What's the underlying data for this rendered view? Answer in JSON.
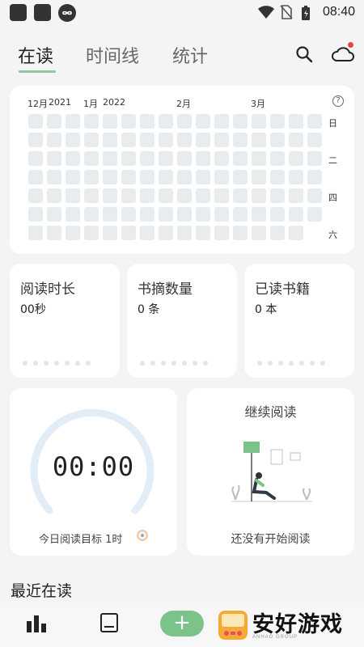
{
  "status_bar": {
    "time": "08:40"
  },
  "tabs": [
    {
      "label": "在读"
    },
    {
      "label": "时间线"
    },
    {
      "label": "统计"
    }
  ],
  "heatmap": {
    "months": [
      {
        "label": "12月"
      },
      {
        "label": "2021"
      },
      {
        "label": "1月"
      },
      {
        "label": "2022"
      },
      {
        "label": "2月"
      },
      {
        "label": "3月"
      }
    ],
    "weekdays": [
      "日",
      "二",
      "四",
      "六"
    ],
    "help": "?"
  },
  "stats": [
    {
      "title": "阅读时长",
      "value": "00秒"
    },
    {
      "title": "书摘数量",
      "value": "0 条"
    },
    {
      "title": "已读书籍",
      "value": "0 本"
    }
  ],
  "timer": {
    "time": "00:00",
    "goal_label": "今日阅读目标 1时"
  },
  "continue_reading": {
    "title": "继续阅读",
    "empty_text": "还没有开始阅读"
  },
  "recent_title": "最近在读",
  "bottom_nav": {
    "fab_label": "+"
  },
  "watermark": {
    "text": "安好游戏",
    "sub": "ANHAO GROUP"
  },
  "colors": {
    "accent": "#7cc389",
    "underline": "#8bc99f",
    "cell": "#e9ecef",
    "ring": "#e3edf7"
  }
}
